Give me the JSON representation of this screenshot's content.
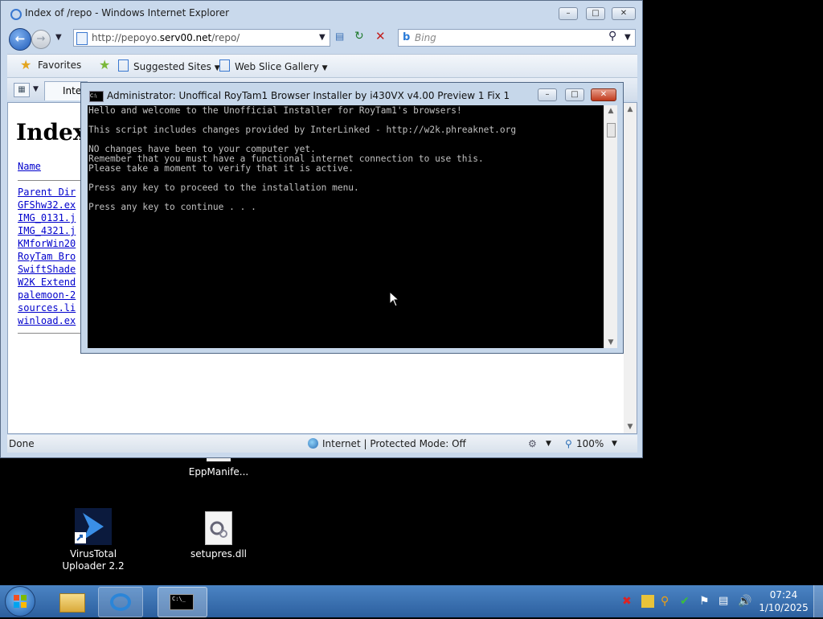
{
  "ie": {
    "title": "Index of /repo - Windows Internet Explorer",
    "address": {
      "prefix": "http://pepoyo.",
      "domain": "serv00.net",
      "path": "/repo/"
    },
    "search_placeholder": "Bing",
    "favorites_label": "Favorites",
    "suggested_sites_label": "Suggested Sites",
    "web_slice_label": "Web Slice Gallery",
    "tab_label": "Inter",
    "page_heading": "Index",
    "column_name": "Name",
    "files": [
      "Parent Dir",
      "GFShw32.ex",
      "IMG_0131.j",
      "IMG_4321.j",
      "KMforWin20",
      "RoyTam Bro",
      "SwiftShade",
      "W2K Extend",
      "palemoon-2",
      "sources.li",
      "winload.ex"
    ],
    "status": {
      "left": "Done",
      "zone": "Internet | Protected Mode: Off",
      "zoom": "100%"
    }
  },
  "console": {
    "title": "Administrator:  Unoffical RoyTam1 Browser Installer by i430VX v4.00 Preview 1 Fix 1",
    "lines": [
      "Hello and welcome to the Unofficial Installer for RoyTam1's browsers!",
      "",
      "This script includes changes provided by InterLinked - http://w2k.phreaknet.org",
      "",
      "NO changes have been to your computer yet.",
      "Remember that you must have a functional internet connection to use this.",
      "Please take a moment to verify that it is active.",
      "",
      "Press any key to proceed to the installation menu.",
      "",
      "Press any key to continue . . ."
    ]
  },
  "desktop": {
    "icons": [
      {
        "label": "EppManife..."
      },
      {
        "label": "VirusTotal\nUploader 2.2"
      },
      {
        "label": "setupres.dll"
      }
    ]
  },
  "taskbar": {
    "clock_time": "07:24",
    "clock_date": "1/10/2025",
    "console_button_text": "C:\\_"
  },
  "colors": {
    "console_bg": "#000000",
    "console_fg": "#c0c0c0",
    "taskbar": "#2c5f9e",
    "link": "#0000cc"
  }
}
